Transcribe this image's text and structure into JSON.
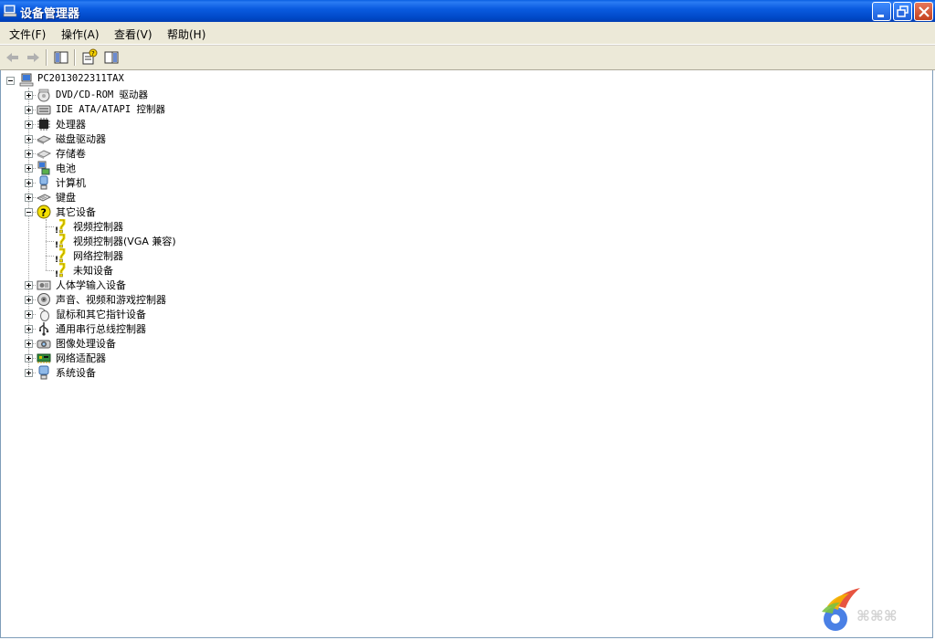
{
  "window": {
    "title": "设备管理器"
  },
  "menu": [
    {
      "label": "文件(F)"
    },
    {
      "label": "操作(A)"
    },
    {
      "label": "查看(V)"
    },
    {
      "label": "帮助(H)"
    }
  ],
  "toolbar": {
    "back_icon": "back-arrow-icon",
    "forward_icon": "forward-arrow-icon",
    "show_hide_tree_icon": "show-hide-console-tree-icon",
    "properties_icon": "properties-help-icon",
    "show_hide_action_icon": "show-hide-action-pane-icon"
  },
  "tree": {
    "root": "PC2013022311TAX",
    "categories": [
      {
        "label": "DVD/CD-ROM 驱动器",
        "icon": "cdrom-icon"
      },
      {
        "label": "IDE ATA/ATAPI 控制器",
        "icon": "ide-controller-icon"
      },
      {
        "label": "处理器",
        "icon": "processor-icon"
      },
      {
        "label": "磁盘驱动器",
        "icon": "disk-drive-icon"
      },
      {
        "label": "存储卷",
        "icon": "storage-volume-icon"
      },
      {
        "label": "电池",
        "icon": "battery-icon"
      },
      {
        "label": "计算机",
        "icon": "computer-icon"
      },
      {
        "label": "键盘",
        "icon": "keyboard-icon"
      },
      {
        "label": "其它设备",
        "icon": "unknown-device-icon",
        "children": [
          {
            "label": "视频控制器"
          },
          {
            "label": "视频控制器(VGA 兼容)"
          },
          {
            "label": "网络控制器"
          },
          {
            "label": "未知设备"
          }
        ]
      },
      {
        "label": "人体学输入设备",
        "icon": "hid-icon"
      },
      {
        "label": "声音、视频和游戏控制器",
        "icon": "sound-icon"
      },
      {
        "label": "鼠标和其它指针设备",
        "icon": "mouse-icon"
      },
      {
        "label": "通用串行总线控制器",
        "icon": "usb-icon"
      },
      {
        "label": "图像处理设备",
        "icon": "imaging-device-icon"
      },
      {
        "label": "网络适配器",
        "icon": "network-adapter-icon"
      },
      {
        "label": "系统设备",
        "icon": "system-device-icon"
      }
    ]
  },
  "colors": {
    "titlebar": "#0a5be0",
    "chrome": "#ece9d8",
    "warning": "#f4e000"
  }
}
